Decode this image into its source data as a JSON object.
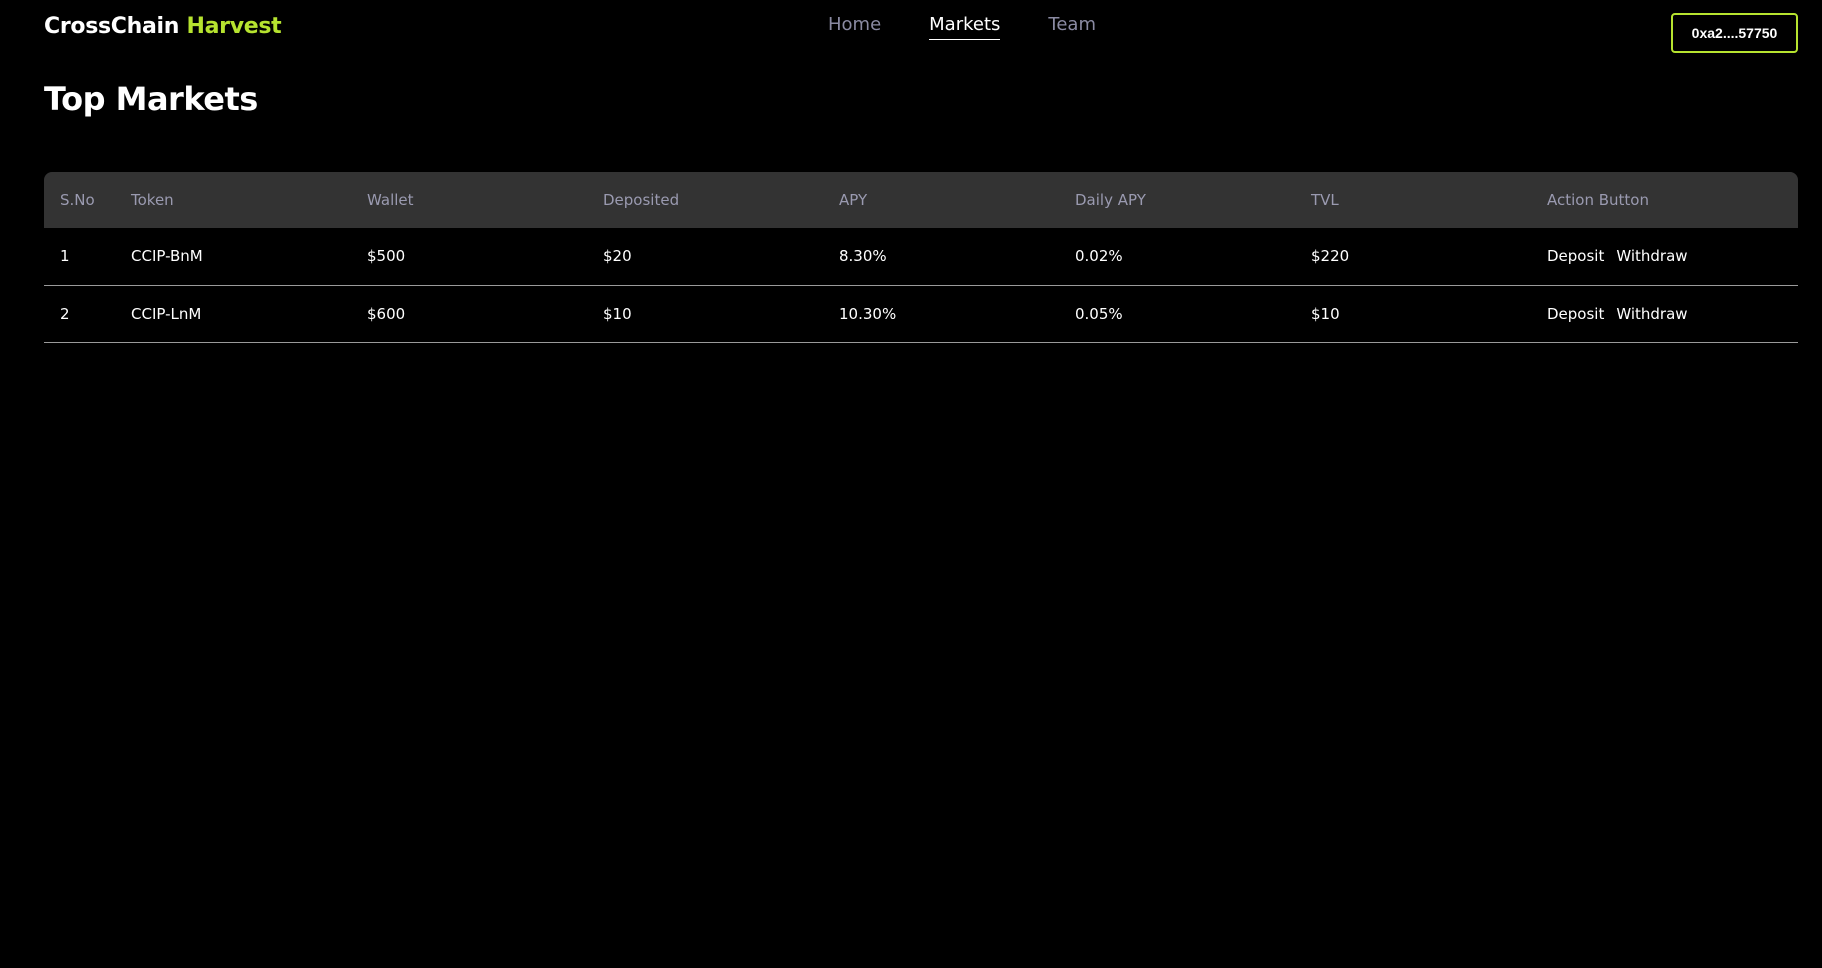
{
  "header": {
    "brand_primary": "CrossChain",
    "brand_accent": "Harvest",
    "nav": [
      {
        "label": "Home",
        "active": false
      },
      {
        "label": "Markets",
        "active": true
      },
      {
        "label": "Team",
        "active": false
      }
    ],
    "wallet_label": "0xa2....57750"
  },
  "page": {
    "title": "Top Markets"
  },
  "table": {
    "columns": [
      "S.No",
      "Token",
      "Wallet",
      "Deposited",
      "APY",
      "Daily APY",
      "TVL",
      "Action Button"
    ],
    "rows": [
      {
        "sno": "1",
        "token": "CCIP-BnM",
        "wallet": "$500",
        "deposited": "$20",
        "apy": "8.30%",
        "daily_apy": "0.02%",
        "tvl": "$220",
        "deposit_label": "Deposit",
        "withdraw_label": "Withdraw"
      },
      {
        "sno": "2",
        "token": "CCIP-LnM",
        "wallet": "$600",
        "deposited": "$10",
        "apy": "10.30%",
        "daily_apy": "0.05%",
        "tvl": "$10",
        "deposit_label": "Deposit",
        "withdraw_label": "Withdraw"
      }
    ]
  },
  "colors": {
    "background": "#000000",
    "accent": "#b6e32f",
    "table_header_bg": "#333333",
    "muted_text": "#9a9ab0"
  }
}
